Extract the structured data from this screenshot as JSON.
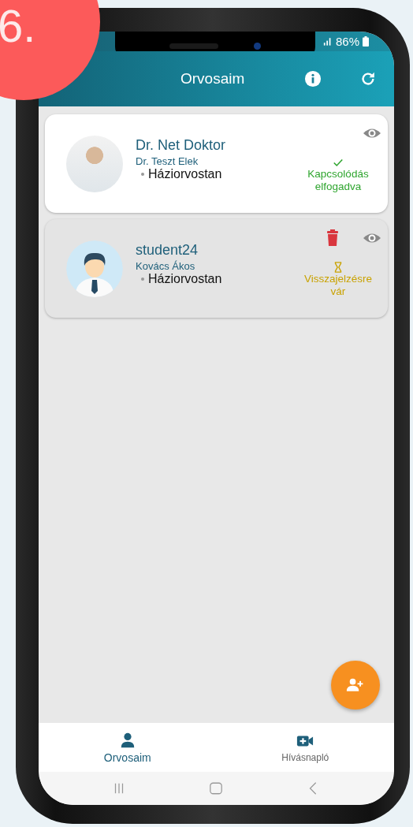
{
  "badge": "6.",
  "status_bar": {
    "battery": "86%"
  },
  "header": {
    "title": "Orvosaim"
  },
  "doctors": [
    {
      "name": "Dr. Net Doktor",
      "subtitle": "Dr. Teszt Elek",
      "specialty": "Háziorvostan",
      "avatar": {
        "kind": "photo"
      },
      "kind": "accepted",
      "status_text": "Kapcsolódás elfogadva",
      "deletable": false
    },
    {
      "name": "student24",
      "subtitle": "Kovács Ákos",
      "specialty": "Háziorvostan",
      "avatar": {
        "kind": "silhouette"
      },
      "kind": "pending",
      "status_text": "Visszajelzésre vár",
      "deletable": true
    }
  ],
  "nav": [
    {
      "label": "Orvosaim",
      "kind": "person",
      "selected": true
    },
    {
      "label": "Hívásnapló",
      "kind": "video",
      "selected": false
    }
  ]
}
